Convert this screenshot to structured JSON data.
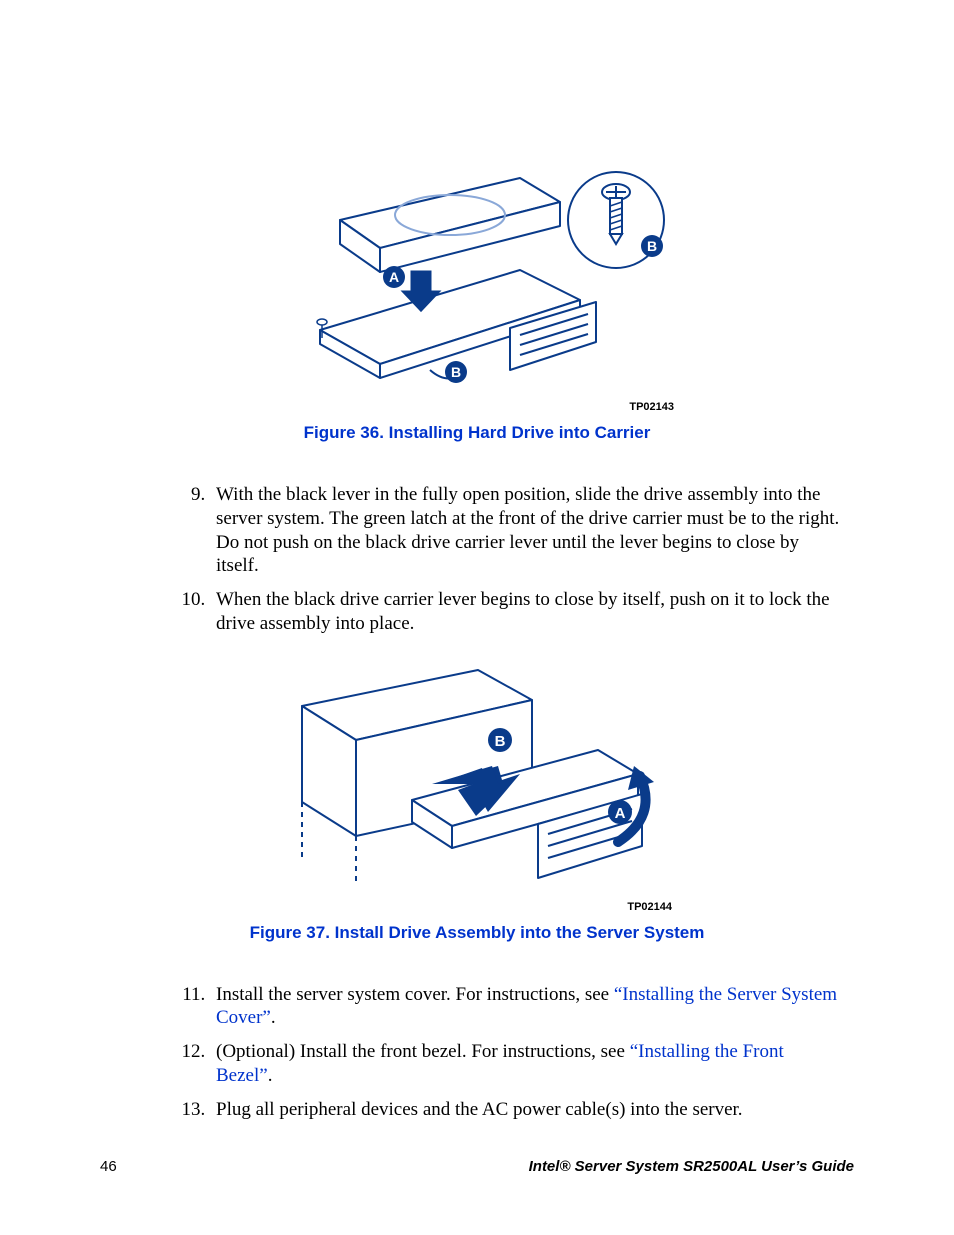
{
  "figure36": {
    "caption": "Figure 36. Installing Hard Drive into Carrier",
    "image_id": "TP02143",
    "callouts": {
      "A": "A",
      "B1": "B",
      "B2": "B"
    }
  },
  "steps_a": {
    "start": 9,
    "items": [
      "With the black lever in the fully open position, slide the drive assembly into the server system. The green latch at the front of the drive carrier must be to the right. Do not push on the black drive carrier lever until the lever begins to close by itself.",
      "When the black drive carrier lever begins to close by itself, push on it to lock the drive assembly into place."
    ]
  },
  "figure37": {
    "caption": "Figure 37. Install Drive Assembly into the Server System",
    "image_id": "TP02144",
    "callouts": {
      "A": "A",
      "B": "B"
    }
  },
  "steps_b": {
    "start": 11,
    "items": [
      {
        "pre": "Install the server system cover. For instructions, see ",
        "link": "“Installing the Server System Cover”",
        "post": "."
      },
      {
        "pre": "(Optional) Install the front bezel. For instructions, see ",
        "link": "“Installing the Front Bezel”",
        "post": "."
      },
      {
        "text": "Plug all peripheral devices and the AC power cable(s) into the server."
      }
    ]
  },
  "footer": {
    "page_number": "46",
    "doc_title": "Intel® Server System SR2500AL User’s Guide"
  }
}
